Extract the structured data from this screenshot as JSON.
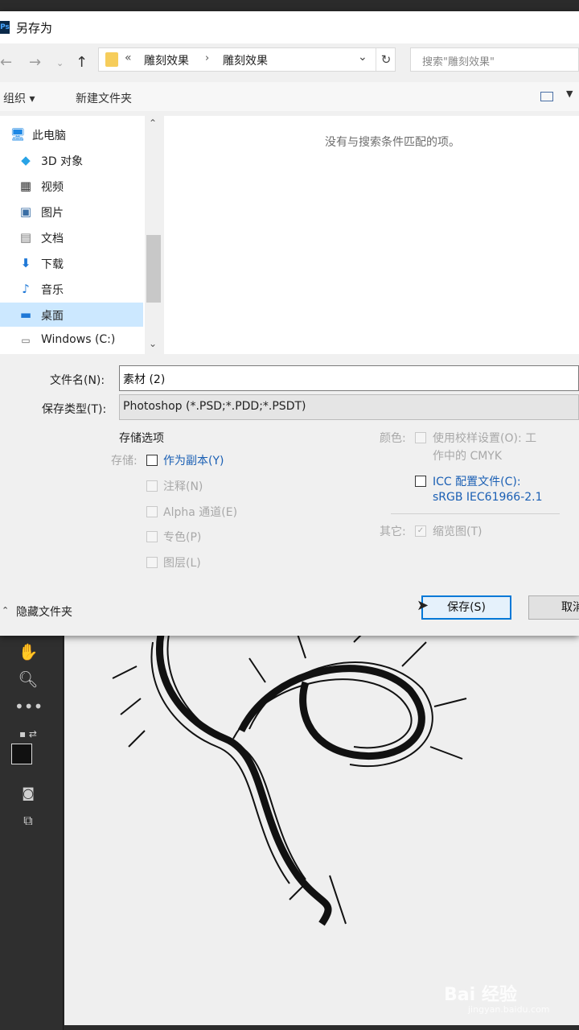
{
  "dialog": {
    "title": "另存为",
    "app_icon_text": "Ps"
  },
  "nav": {
    "back_icon": "back-arrow-icon",
    "forward_icon": "forward-arrow-icon",
    "up_icon": "up-arrow-icon",
    "breadcrumb_prefix": "«",
    "crumbs": [
      "雕刻效果",
      "雕刻效果"
    ],
    "search_placeholder": "搜索\"雕刻效果\""
  },
  "commands": {
    "organize": "组织 ▾",
    "new_folder": "新建文件夹"
  },
  "sidebar": {
    "items": [
      {
        "label": "此电脑",
        "icon": "computer-icon"
      },
      {
        "label": "3D 对象",
        "icon": "cube-icon"
      },
      {
        "label": "视频",
        "icon": "film-icon"
      },
      {
        "label": "图片",
        "icon": "picture-icon"
      },
      {
        "label": "文档",
        "icon": "document-icon"
      },
      {
        "label": "下载",
        "icon": "download-icon"
      },
      {
        "label": "音乐",
        "icon": "music-icon"
      },
      {
        "label": "桌面",
        "icon": "desktop-icon",
        "selected": true
      },
      {
        "label": "Windows (C:)",
        "icon": "drive-icon"
      }
    ]
  },
  "content": {
    "empty_message": "没有与搜索条件匹配的项。"
  },
  "fields": {
    "filename_label": "文件名(N):",
    "filename_value": "素材 (2)",
    "filetype_label": "保存类型(T):",
    "filetype_value": "Photoshop (*.PSD;*.PDD;*.PSDT)"
  },
  "options": {
    "section_title": "存储选项",
    "store_label": "存储:",
    "as_copy": "作为副本(Y)",
    "notes": "注释(N)",
    "alpha": "Alpha 通道(E)",
    "spot": "专色(P)",
    "layers": "图层(L)",
    "color_label": "颜色:",
    "proof_line1": "使用校样设置(O): 工",
    "proof_line2": "作中的 CMYK",
    "icc_line1": "ICC 配置文件(C):",
    "icc_line2": "sRGB IEC61966-2.1",
    "other_label": "其它:",
    "thumbnail": "缩览图(T)"
  },
  "footer": {
    "hide_folders": "隐藏文件夹",
    "save": "保存(S)",
    "cancel": "取消"
  },
  "watermark": {
    "brand": "Bai 经验",
    "url": "jingyan.baidu.com"
  },
  "colors": {
    "accent": "#0078d7",
    "link_blue": "#1a5fb4"
  }
}
